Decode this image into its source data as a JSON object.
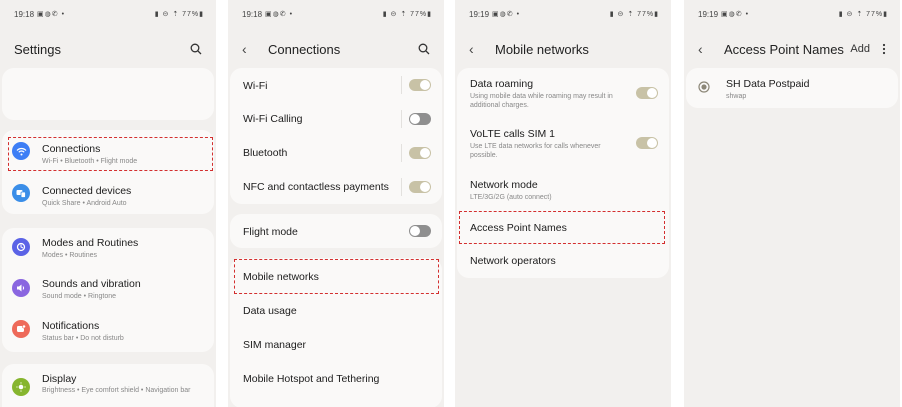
{
  "status_bars": [
    {
      "time": "19:18",
      "icons": "▣◍✆ •",
      "right": "▮ ⊝ ⇡ 77%▮"
    },
    {
      "time": "19:18",
      "icons": "▣◍✆ •",
      "right": "▮ ⊝ ⇡ 77%▮"
    },
    {
      "time": "19:19",
      "icons": "▣◍✆ •",
      "right": "▮ ⊝ ⇡ 77%▮"
    },
    {
      "time": "19:19",
      "icons": "▣◍✆ •",
      "right": "▮ ⊝ ⇡ 77%▮"
    }
  ],
  "settings": {
    "title": "Settings",
    "items": [
      {
        "title": "Connections",
        "subtitle": "Wi-Fi  •  Bluetooth  •  Flight mode",
        "icon": "wifi-icon",
        "color": "#3d7ef5"
      },
      {
        "title": "Connected devices",
        "subtitle": "Quick Share  •  Android Auto",
        "icon": "devices-icon",
        "color": "#3b8ee8"
      },
      {
        "title": "Modes and Routines",
        "subtitle": "Modes  •  Routines",
        "icon": "modes-icon",
        "color": "#5b63e6"
      },
      {
        "title": "Sounds and vibration",
        "subtitle": "Sound mode  •  Ringtone",
        "icon": "sound-icon",
        "color": "#8a66e0"
      },
      {
        "title": "Notifications",
        "subtitle": "Status bar  •  Do not disturb",
        "icon": "notifications-icon",
        "color": "#ee6a5a"
      },
      {
        "title": "Display",
        "subtitle": "Brightness  •  Eye comfort shield  •  Navigation bar",
        "icon": "display-icon",
        "color": "#86b52e"
      }
    ]
  },
  "connections": {
    "title": "Connections",
    "items": [
      {
        "label": "Wi-Fi",
        "toggle": "on"
      },
      {
        "label": "Wi-Fi Calling",
        "toggle": "off"
      },
      {
        "label": "Bluetooth",
        "toggle": "on"
      },
      {
        "label": "NFC and contactless payments",
        "toggle": "on"
      },
      {
        "label": "Flight mode",
        "toggle": "off"
      },
      {
        "label": "Mobile networks"
      },
      {
        "label": "Data usage"
      },
      {
        "label": "SIM manager"
      },
      {
        "label": "Mobile Hotspot and Tethering"
      }
    ]
  },
  "mobile_networks": {
    "title": "Mobile networks",
    "items": [
      {
        "title": "Data roaming",
        "subtitle": "Using mobile data while roaming may result in additional charges.",
        "toggle": "on"
      },
      {
        "title": "VoLTE calls SIM 1",
        "subtitle": "Use LTE data networks for calls whenever possible.",
        "toggle": "on"
      },
      {
        "title": "Network mode",
        "subtitle": "LTE/3G/2G (auto connect)"
      },
      {
        "title": "Access Point Names"
      },
      {
        "title": "Network operators"
      }
    ]
  },
  "apn": {
    "title": "Access Point Names",
    "add_label": "Add",
    "more_icon": "more-vert-icon",
    "items": [
      {
        "name": "SH Data Postpaid",
        "value": "shwap",
        "selected": true
      }
    ]
  },
  "colors": {
    "highlight": "#d32f2f",
    "toggle_on": "#c8c2a6",
    "toggle_off": "#8f8f8f",
    "background": "#f2f0ee",
    "card": "#faf9f8"
  }
}
